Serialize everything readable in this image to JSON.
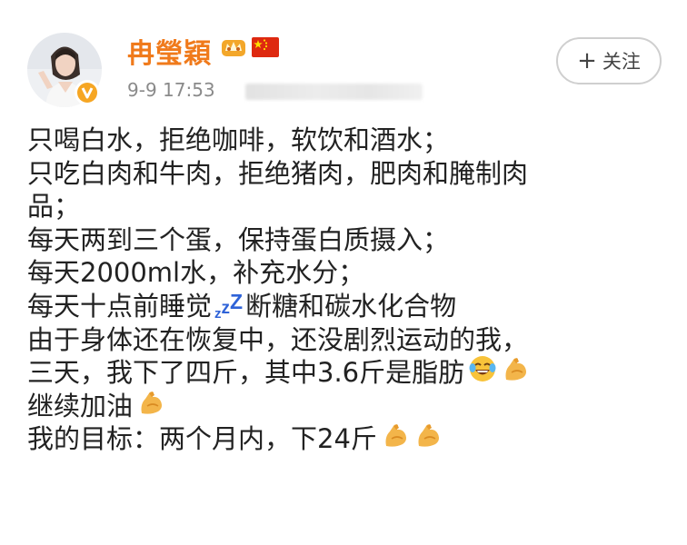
{
  "header": {
    "username": "冉瑩穎",
    "timestamp": "9-9 17:53",
    "follow_plus": "+",
    "follow_label": "关注"
  },
  "post": {
    "lines": [
      "只喝白水，拒绝咖啡，软饮和酒水；",
      "只吃白肉和牛肉，拒绝猪肉，肥肉和腌制肉",
      "品；",
      "每天两到三个蛋，保持蛋白质摄入；",
      "每天2000ml水，补充水分；"
    ],
    "line6_before": "每天十点前睡觉",
    "line6_after": "断糖和碳水化合物",
    "line7": "由于身体还在恢复中，还没剧烈运动的我，",
    "line8": "三天，我下了四斤，其中3.6斤是脂肪",
    "line9": "继续加油",
    "line10": "我的目标：两个月内，下24斤"
  },
  "icons": {
    "zzz_letters": [
      "z",
      "z",
      "Z"
    ],
    "zzz_color": "#2f63d8",
    "emoji_tears": "face-with-tears-of-joy-icon",
    "emoji_muscle": "flexed-biceps-icon"
  },
  "colors": {
    "username": "#f07a1b",
    "timestamp": "#8a8a8a",
    "text": "#222222",
    "verified_badge": "#f6a623"
  }
}
